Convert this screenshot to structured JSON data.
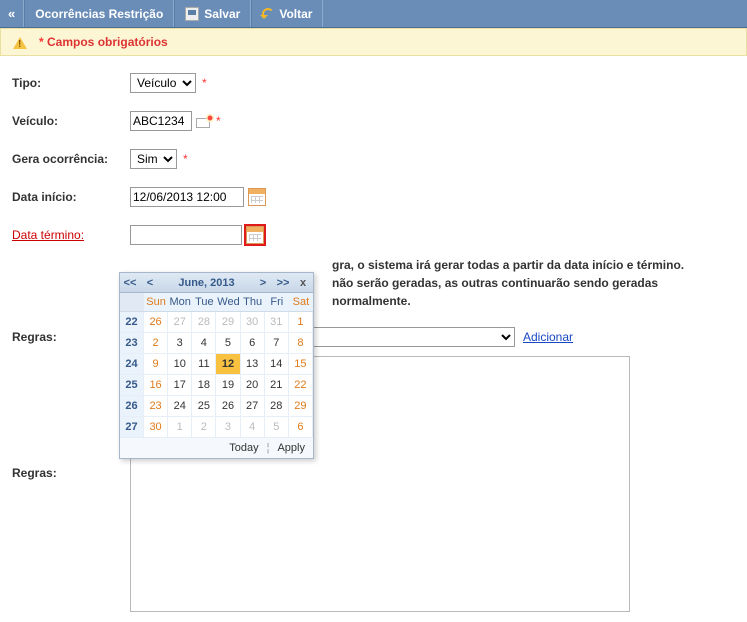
{
  "header": {
    "chevrons": "«",
    "title": "Ocorrências Restrição",
    "save_label": "Salvar",
    "back_label": "Voltar"
  },
  "notice": {
    "star": "*",
    "text": "Campos obrigatórios"
  },
  "form": {
    "tipo": {
      "label": "Tipo:",
      "value": "Veículo",
      "options": [
        "Veículo"
      ]
    },
    "veiculo": {
      "label": "Veículo:",
      "value": "ABC1234"
    },
    "gera": {
      "label": "Gera ocorrência:",
      "value": "Sim",
      "options": [
        "Sim"
      ]
    },
    "data_inicio": {
      "label": "Data início:",
      "value": "12/06/2013 12:00"
    },
    "data_termino": {
      "label": "Data término:",
      "value": ""
    },
    "hint_line_suffix1": "gra, o sistema irá gerar todas a partir da data início e término.",
    "hint_line_suffix2": "não serão geradas, as outras continuarão sendo geradas normalmente.",
    "regras": {
      "label": "Regras:",
      "selected": "",
      "options": [
        ""
      ],
      "add_link": "Adicionar"
    },
    "regras2_label": "Regras:"
  },
  "datepicker": {
    "nav_prev_year": "<<",
    "nav_prev_month": "<",
    "title": "June, 2013",
    "nav_next_month": ">",
    "nav_next_year": ">>",
    "close": "x",
    "dow": [
      "",
      "Sun",
      "Mon",
      "Tue",
      "Wed",
      "Thu",
      "Fri",
      "Sat"
    ],
    "weeks": [
      {
        "wk": "22",
        "days": [
          {
            "d": "26",
            "other": true,
            "weekend": true
          },
          {
            "d": "27",
            "other": true
          },
          {
            "d": "28",
            "other": true
          },
          {
            "d": "29",
            "other": true
          },
          {
            "d": "30",
            "other": true
          },
          {
            "d": "31",
            "other": true
          },
          {
            "d": "1",
            "weekend": true
          }
        ]
      },
      {
        "wk": "23",
        "days": [
          {
            "d": "2",
            "weekend": true
          },
          {
            "d": "3"
          },
          {
            "d": "4"
          },
          {
            "d": "5"
          },
          {
            "d": "6"
          },
          {
            "d": "7"
          },
          {
            "d": "8",
            "weekend": true
          }
        ]
      },
      {
        "wk": "24",
        "days": [
          {
            "d": "9",
            "weekend": true
          },
          {
            "d": "10"
          },
          {
            "d": "11"
          },
          {
            "d": "12",
            "today": true
          },
          {
            "d": "13"
          },
          {
            "d": "14"
          },
          {
            "d": "15",
            "weekend": true
          }
        ]
      },
      {
        "wk": "25",
        "days": [
          {
            "d": "16",
            "weekend": true
          },
          {
            "d": "17"
          },
          {
            "d": "18"
          },
          {
            "d": "19"
          },
          {
            "d": "20"
          },
          {
            "d": "21"
          },
          {
            "d": "22",
            "weekend": true
          }
        ]
      },
      {
        "wk": "26",
        "days": [
          {
            "d": "23",
            "weekend": true
          },
          {
            "d": "24"
          },
          {
            "d": "25"
          },
          {
            "d": "26"
          },
          {
            "d": "27"
          },
          {
            "d": "28"
          },
          {
            "d": "29",
            "weekend": true
          }
        ]
      },
      {
        "wk": "27",
        "days": [
          {
            "d": "30",
            "weekend": true
          },
          {
            "d": "1",
            "other": true
          },
          {
            "d": "2",
            "other": true
          },
          {
            "d": "3",
            "other": true
          },
          {
            "d": "4",
            "other": true
          },
          {
            "d": "5",
            "other": true
          },
          {
            "d": "6",
            "other": true,
            "weekend": true
          }
        ]
      }
    ],
    "today_label": "Today",
    "apply_label": "Apply"
  }
}
